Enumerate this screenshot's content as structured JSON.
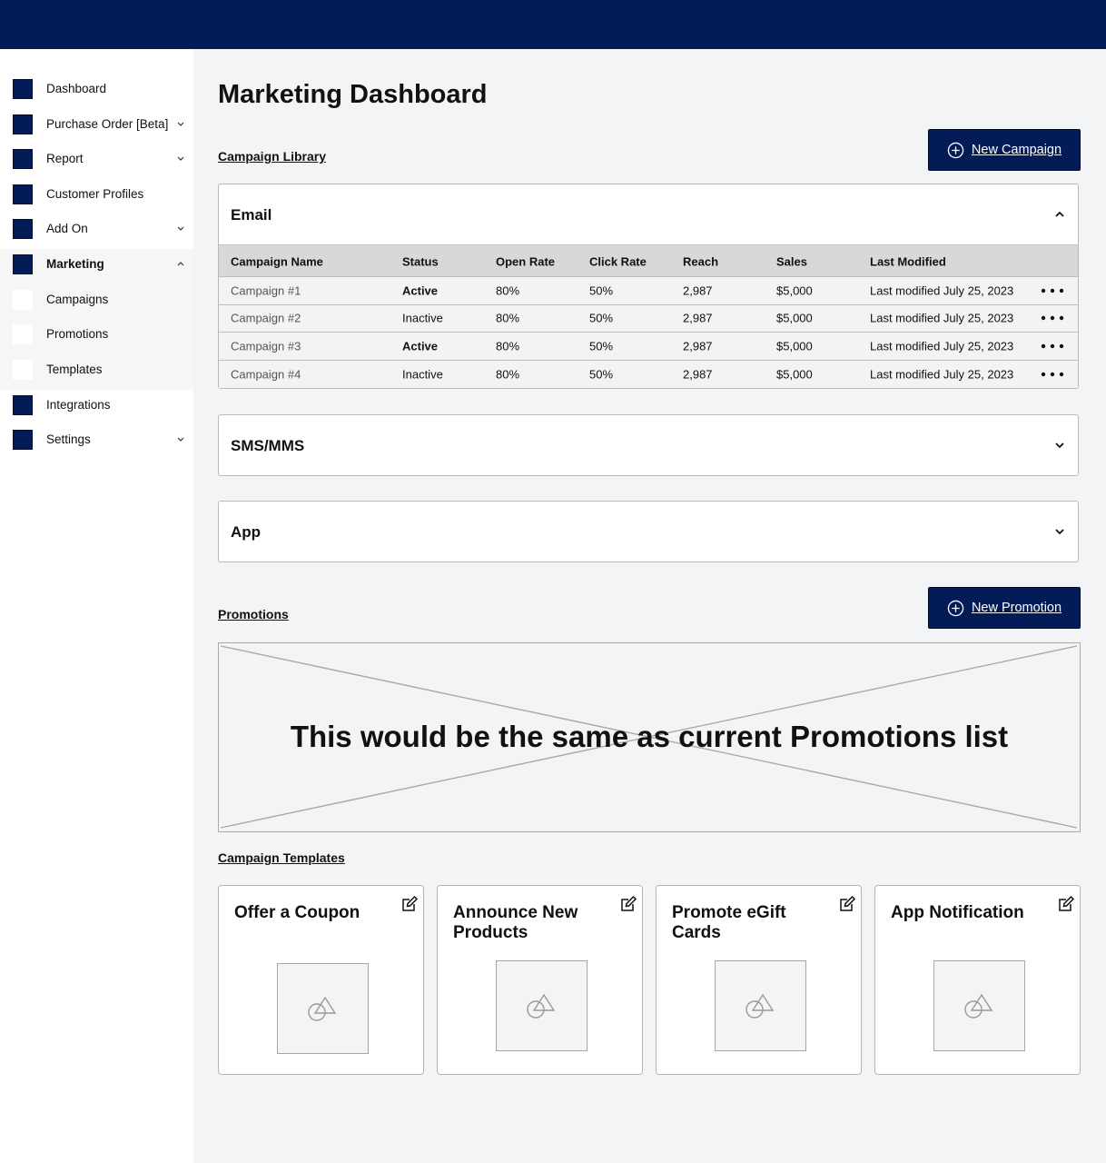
{
  "sidebar": {
    "items": [
      {
        "label": "Dashboard",
        "icon": "square-icon",
        "chevron": "none"
      },
      {
        "label": "Purchase Order [Beta]",
        "icon": "square-icon",
        "chevron": "down"
      },
      {
        "label": "Report",
        "icon": "square-icon",
        "chevron": "down"
      },
      {
        "label": "Customer Profiles",
        "icon": "square-icon",
        "chevron": "none"
      },
      {
        "label": "Add On",
        "icon": "square-icon",
        "chevron": "down"
      },
      {
        "label": "Marketing",
        "icon": "square-icon",
        "chevron": "up",
        "active": true
      },
      {
        "label": "Campaigns",
        "sub": true
      },
      {
        "label": "Promotions",
        "sub": true
      },
      {
        "label": "Templates",
        "sub": true
      },
      {
        "label": "Integrations",
        "icon": "square-icon",
        "chevron": "none"
      },
      {
        "label": "Settings",
        "icon": "square-icon",
        "chevron": "down"
      }
    ]
  },
  "main": {
    "title": "Marketing Dashboard",
    "campaign_library": {
      "link": "Campaign Library",
      "new_button": "New Campaign",
      "email": {
        "title": "Email",
        "columns": [
          "Campaign Name",
          "Status",
          "Open Rate",
          "Click Rate",
          "Reach",
          "Sales",
          "Last Modified"
        ],
        "rows": [
          {
            "name": "Campaign #1",
            "status": "Active",
            "open": "80%",
            "click": "50%",
            "reach": "2,987",
            "sales": "$5,000",
            "modified": "Last modified July 25, 2023"
          },
          {
            "name": "Campaign #2",
            "status": "Inactive",
            "open": "80%",
            "click": "50%",
            "reach": "2,987",
            "sales": "$5,000",
            "modified": "Last modified July 25, 2023"
          },
          {
            "name": "Campaign #3",
            "status": "Active",
            "open": "80%",
            "click": "50%",
            "reach": "2,987",
            "sales": "$5,000",
            "modified": "Last modified July 25, 2023"
          },
          {
            "name": "Campaign #4",
            "status": "Inactive",
            "open": "80%",
            "click": "50%",
            "reach": "2,987",
            "sales": "$5,000",
            "modified": "Last modified July 25, 2023"
          }
        ]
      },
      "sms": {
        "title": "SMS/MMS"
      },
      "app": {
        "title": "App"
      }
    },
    "promotions": {
      "link": "Promotions",
      "new_button": "New Promotion",
      "placeholder_text": "This would be the same as current Promotions list"
    },
    "templates": {
      "link": "Campaign Templates",
      "cards": [
        {
          "title": "Offer a Coupon"
        },
        {
          "title": "Announce New Products"
        },
        {
          "title": "Promote eGift Cards"
        },
        {
          "title": "App Notification"
        }
      ]
    }
  },
  "colors": {
    "brand": "#031b56",
    "page_bg": "#f3f4f6",
    "table_header": "#d8d8d8"
  }
}
